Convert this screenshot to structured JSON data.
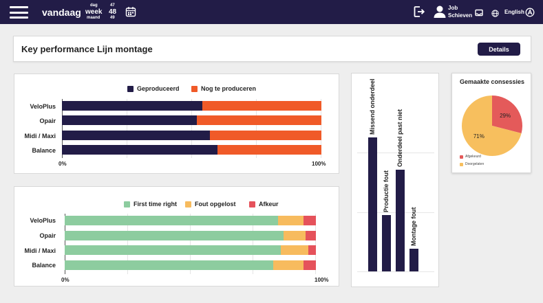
{
  "header": {
    "today": "vandaag",
    "period": {
      "day_label": "dag",
      "day": "47",
      "week_label": "week",
      "week": "48",
      "month_label": "maand",
      "month": "49"
    },
    "user": {
      "first": "Job",
      "last": "Schieven"
    },
    "language": "English",
    "icons": [
      "menu-icon",
      "calendar-icon",
      "logout-icon",
      "user-icon",
      "inbox-icon",
      "globe-icon",
      "language-toggle-icon"
    ]
  },
  "page": {
    "title": "Key performance Lijn montage",
    "details_label": "Details"
  },
  "colors": {
    "navy": "#221c47",
    "orange": "#f05a28",
    "green": "#8dcc9f",
    "amber": "#f7bb5e",
    "red": "#e5525b",
    "pie_red": "#e45a5a",
    "pie_yellow": "#f7bf5e"
  },
  "chart_data": [
    {
      "type": "bar",
      "orientation": "horizontal",
      "stacked": true,
      "categories": [
        "VeloPlus",
        "Opair",
        "Midi / Maxi",
        "Balance"
      ],
      "series": [
        {
          "name": "Geproduceerd",
          "values": [
            54,
            52,
            57,
            60
          ]
        },
        {
          "name": "Nog te produceren",
          "values": [
            46,
            48,
            43,
            40
          ]
        }
      ],
      "xlim": [
        0,
        100
      ],
      "tick_labels": [
        "0%",
        "100%"
      ],
      "legend": "top"
    },
    {
      "type": "bar",
      "orientation": "horizontal",
      "stacked": true,
      "categories": [
        "VeloPlus",
        "Opair",
        "Midi / Maxi",
        "Balance"
      ],
      "series": [
        {
          "name": "First time right",
          "values": [
            85,
            87,
            86,
            83
          ]
        },
        {
          "name": "Fout opgelost",
          "values": [
            10,
            9,
            11,
            12
          ]
        },
        {
          "name": "Afkeur",
          "values": [
            5,
            4,
            3,
            5
          ]
        }
      ],
      "xlim": [
        0,
        100
      ],
      "tick_labels": [
        "0%",
        "100%"
      ],
      "legend": "top"
    },
    {
      "type": "bar",
      "orientation": "vertical",
      "categories": [
        "Missend onderdeel",
        "Productie fout",
        "Onderdeel past niet",
        "Montage fout"
      ],
      "values": [
        195,
        82,
        148,
        33
      ],
      "ylim": [
        0,
        260
      ]
    },
    {
      "type": "pie",
      "title": "Gemaakte consessies",
      "labels": [
        "Afgekeurd",
        "Doorgelaten"
      ],
      "values": [
        29,
        71
      ],
      "value_labels": [
        "29%",
        "71%"
      ],
      "legend": "bottom-left"
    }
  ]
}
